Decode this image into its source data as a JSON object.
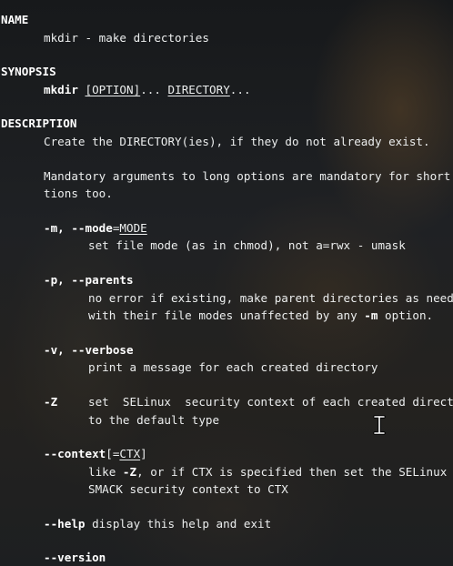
{
  "man_page": {
    "name": {
      "heading": "NAME",
      "text": "mkdir - make directories"
    },
    "synopsis": {
      "heading": "SYNOPSIS",
      "command": "mkdir",
      "option": "[OPTION]",
      "sep": "... ",
      "directory": "DIRECTORY",
      "trail": "..."
    },
    "description": {
      "heading": "DESCRIPTION",
      "line1": "Create the DIRECTORY(ies), if they do not already exist.",
      "line2": "Mandatory arguments to long options are mandatory for short op-",
      "line3": "tions too."
    },
    "options": {
      "mode": {
        "flag": "-m, --mode",
        "eq": "=",
        "arg": "MODE",
        "desc": "set file mode (as in chmod), not a=rwx - umask"
      },
      "parents": {
        "flag": "-p, --parents",
        "desc1": "no error if existing, make parent directories as needed,",
        "desc2a": "with their file modes unaffected by any ",
        "desc2b": "-m",
        "desc2c": " option."
      },
      "verbose": {
        "flag": "-v, --verbose",
        "desc": "print a message for each created directory"
      },
      "z": {
        "flag": "-Z",
        "desc1": "set  SELinux  security context of each created directory",
        "desc2": "to the default type"
      },
      "context": {
        "flag": "--context",
        "bracket_open": "[=",
        "arg": "CTX",
        "bracket_close": "]",
        "desc1a": "like ",
        "desc1b": "-Z",
        "desc1c": ", or if CTX is specified then set the SELinux  or",
        "desc2": "SMACK security context to CTX"
      },
      "help": {
        "flag": "--help",
        "desc": " display this help and exit"
      },
      "version": {
        "flag": "--version"
      }
    }
  },
  "cursor": {
    "icon": "text-cursor-icon"
  }
}
